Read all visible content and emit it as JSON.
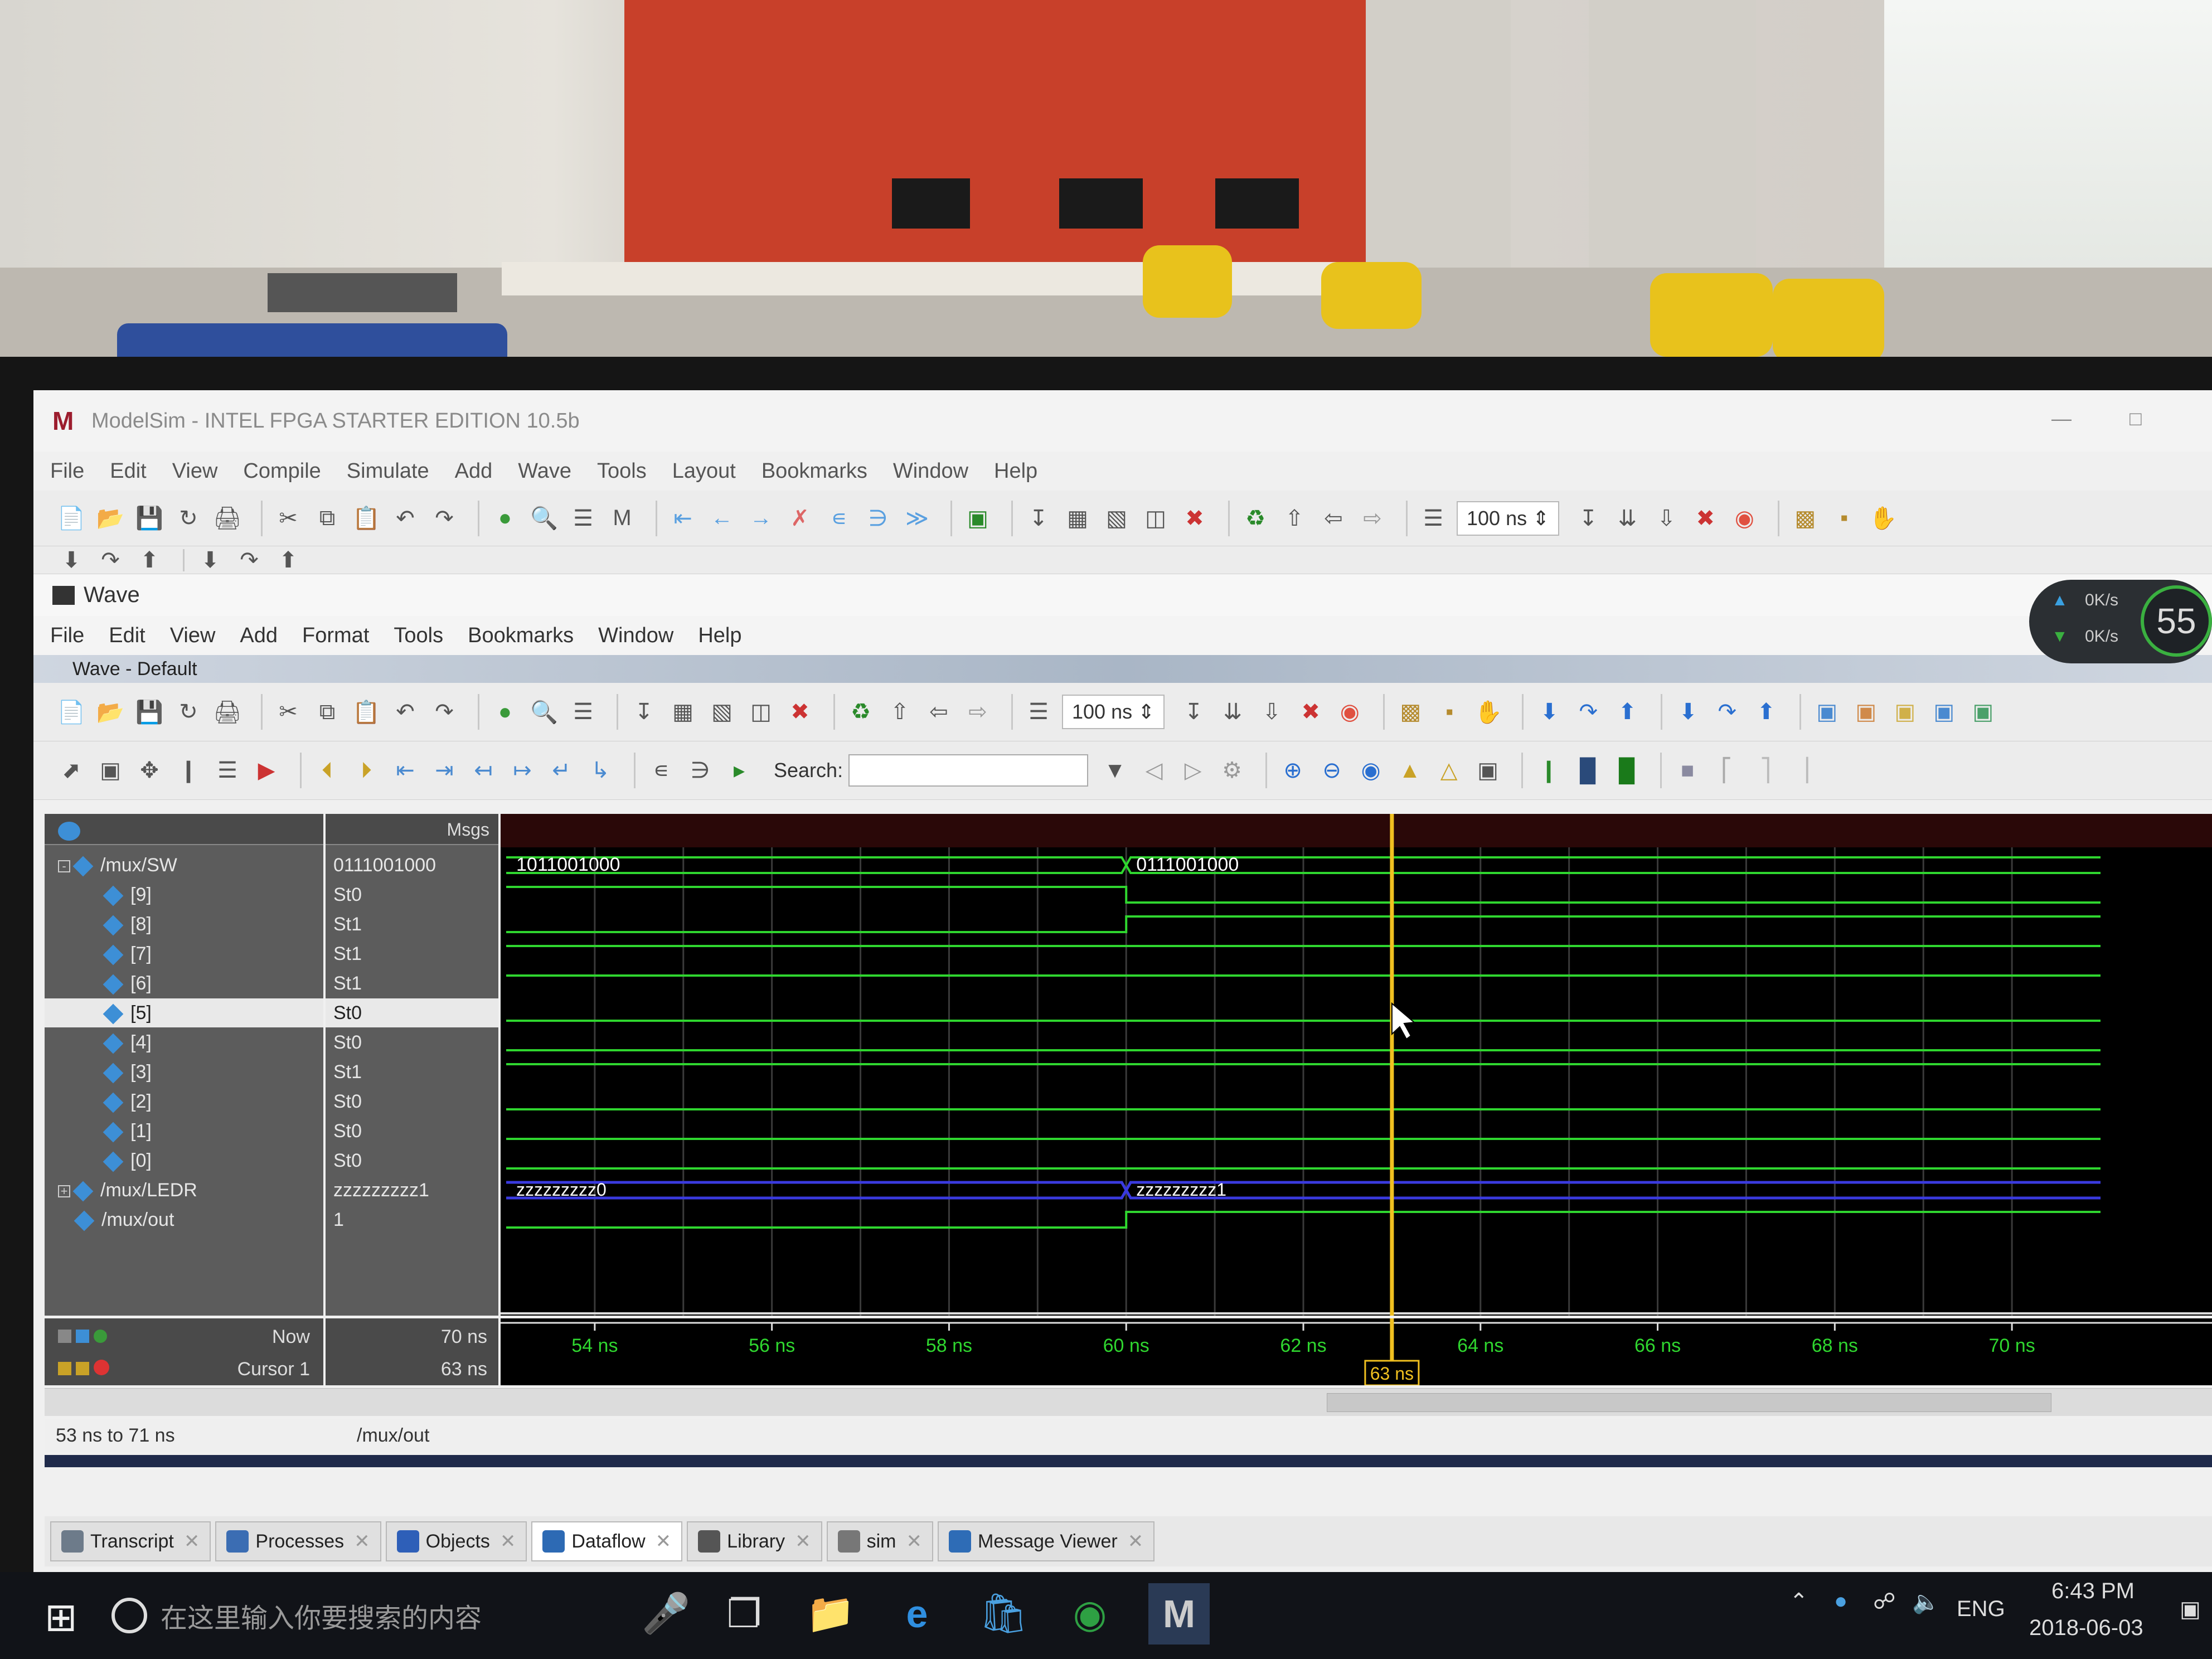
{
  "window": {
    "title": "ModelSim - INTEL FPGA STARTER EDITION 10.5b"
  },
  "main_menu": [
    "File",
    "Edit",
    "View",
    "Compile",
    "Simulate",
    "Add",
    "Wave",
    "Tools",
    "Layout",
    "Bookmarks",
    "Window",
    "Help"
  ],
  "main_toolbar": {
    "run_length": "100 ns"
  },
  "wave_window": {
    "title": "Wave",
    "menu": [
      "File",
      "Edit",
      "View",
      "Add",
      "Format",
      "Tools",
      "Bookmarks",
      "Window",
      "Help"
    ],
    "subtitle": "Wave - Default",
    "run_length": "100 ns",
    "search_label": "Search:",
    "msgs_header": "Msgs"
  },
  "signals": [
    {
      "name": "/mux/SW",
      "value": "0111001000",
      "expand": "-",
      "level": 0
    },
    {
      "name": "[9]",
      "value": "St0",
      "level": 1
    },
    {
      "name": "[8]",
      "value": "St1",
      "level": 1
    },
    {
      "name": "[7]",
      "value": "St1",
      "level": 1
    },
    {
      "name": "[6]",
      "value": "St1",
      "level": 1
    },
    {
      "name": "[5]",
      "value": "St0",
      "level": 1,
      "selected": true
    },
    {
      "name": "[4]",
      "value": "St0",
      "level": 1
    },
    {
      "name": "[3]",
      "value": "St1",
      "level": 1
    },
    {
      "name": "[2]",
      "value": "St0",
      "level": 1
    },
    {
      "name": "[1]",
      "value": "St0",
      "level": 1
    },
    {
      "name": "[0]",
      "value": "St0",
      "level": 1
    },
    {
      "name": "/mux/LEDR",
      "value": "zzzzzzzzz1",
      "expand": "+",
      "level": 0
    },
    {
      "name": "/mux/out",
      "value": "1",
      "level": 0
    }
  ],
  "waveform": {
    "bus_labels": {
      "sw_before": "1011001000",
      "sw_after": "0111001000",
      "ledr_before": "zzzzzzzzz0",
      "ledr_after": "zzzzzzzzz1"
    },
    "time_ticks": [
      "54 ns",
      "56 ns",
      "58 ns",
      "60 ns",
      "62 ns",
      "64 ns",
      "66 ns",
      "68 ns",
      "70 ns"
    ],
    "cursor_time_label": "63 ns"
  },
  "cursor_panel": {
    "now_label": "Now",
    "now_value": "70 ns",
    "cursor_label": "Cursor 1",
    "cursor_value": "63 ns"
  },
  "status_bar": {
    "range": "53 ns to 71 ns",
    "selected_signal": "/mux/out"
  },
  "tabs": [
    {
      "label": "Transcript",
      "color": "#6d7b8a"
    },
    {
      "label": "Processes",
      "color": "#3b6db3"
    },
    {
      "label": "Objects",
      "color": "#2e5fb8"
    },
    {
      "label": "Dataflow",
      "color": "#2d6ab4",
      "active": true
    },
    {
      "label": "Library",
      "color": "#555555"
    },
    {
      "label": "sim",
      "color": "#777777"
    },
    {
      "label": "Message Viewer",
      "color": "#2e6cb6"
    }
  ],
  "taskbar": {
    "search_placeholder": "在这里输入你要搜索的内容",
    "language": "ENG",
    "time": "6:43 PM",
    "date": "2018-06-03"
  },
  "net_widget": {
    "up": "0K/s",
    "down": "0K/s",
    "percent": "55"
  }
}
